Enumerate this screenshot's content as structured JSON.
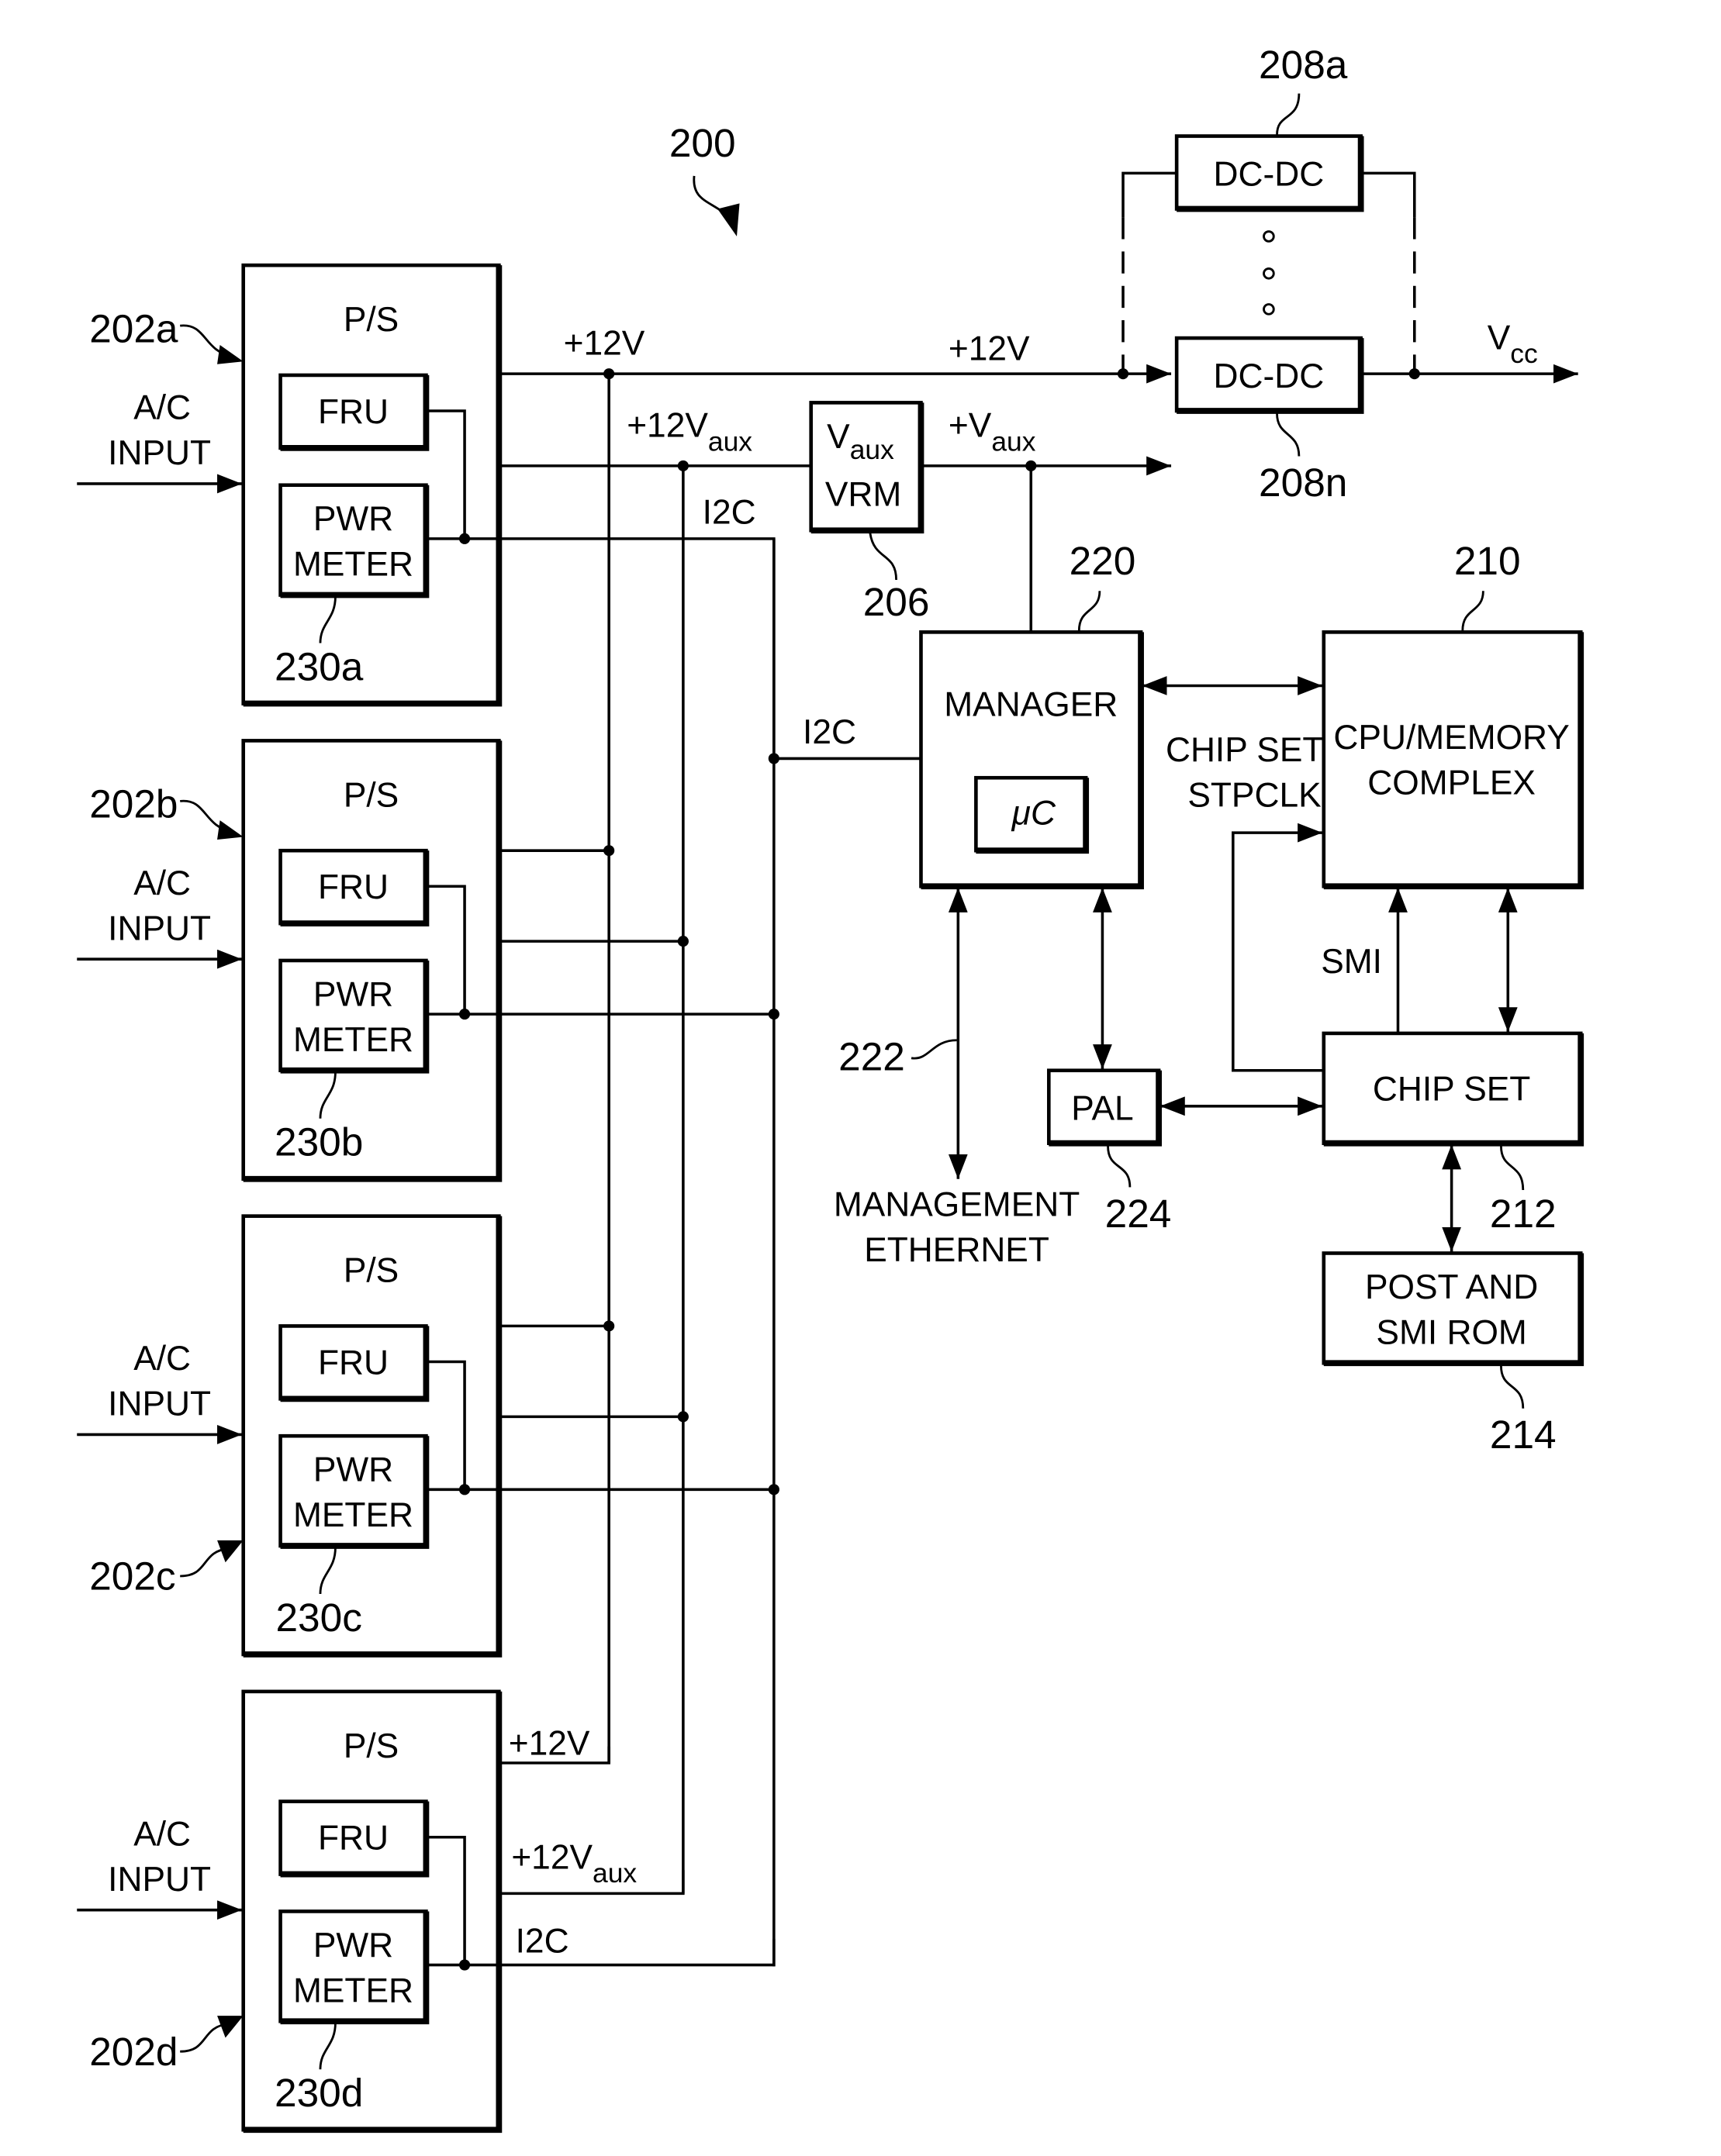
{
  "figure": {
    "reference": "200"
  },
  "power_supplies": [
    {
      "ref": "202a",
      "ref_side": "top",
      "title": "P/S",
      "ac_input": [
        "A/C",
        "INPUT"
      ],
      "fru_label": "FRU",
      "meter_label": [
        "PWR",
        "METER"
      ],
      "meter_ref": "230a"
    },
    {
      "ref": "202b",
      "ref_side": "top",
      "title": "P/S",
      "ac_input": [
        "A/C",
        "INPUT"
      ],
      "fru_label": "FRU",
      "meter_label": [
        "PWR",
        "METER"
      ],
      "meter_ref": "230b"
    },
    {
      "ref": "202c",
      "ref_side": "bottom",
      "title": "P/S",
      "ac_input": [
        "A/C",
        "INPUT"
      ],
      "fru_label": "FRU",
      "meter_label": [
        "PWR",
        "METER"
      ],
      "meter_ref": "230c"
    },
    {
      "ref": "202d",
      "ref_side": "bottom",
      "title": "P/S",
      "ac_input": [
        "A/C",
        "INPUT"
      ],
      "fru_label": "FRU",
      "meter_label": [
        "PWR",
        "METER"
      ],
      "meter_ref": "230d"
    }
  ],
  "bus_labels": {
    "v12_top": "+12V",
    "v12aux_top": "+12V",
    "v12aux_top_sub": "aux",
    "i2c_top": "I2C",
    "v12_mid": "+12V",
    "i2c_manager": "I2C",
    "v12_bottom": "+12V",
    "v12aux_bottom": "+12V",
    "v12aux_bottom_sub": "aux",
    "i2c_bottom": "I2C",
    "vaux_out": "+V",
    "vaux_out_sub": "aux",
    "vcc": "V",
    "vcc_sub": "cc"
  },
  "vrm": {
    "line1": "V",
    "line1_sub": "aux",
    "line2": "VRM",
    "ref": "206"
  },
  "dcdc": [
    {
      "label": "DC-DC",
      "ref": "208a"
    },
    {
      "label": "DC-DC",
      "ref": "208n"
    }
  ],
  "manager": {
    "label": "MANAGER",
    "inner": "μC",
    "ref": "220"
  },
  "cpu": {
    "line1": "CPU/MEMORY",
    "line2": "COMPLEX",
    "ref": "210"
  },
  "chipset": {
    "label": "CHIP SET",
    "ref": "212"
  },
  "stpclk": {
    "line1": "CHIP SET",
    "line2": "STPCLK"
  },
  "smi": {
    "label": "SMI"
  },
  "pal": {
    "label": "PAL",
    "ref": "224"
  },
  "rom": {
    "line1": "POST AND",
    "line2": "SMI ROM",
    "ref": "214"
  },
  "ethernet": {
    "line1": "MANAGEMENT",
    "line2": "ETHERNET",
    "ref": "222"
  }
}
